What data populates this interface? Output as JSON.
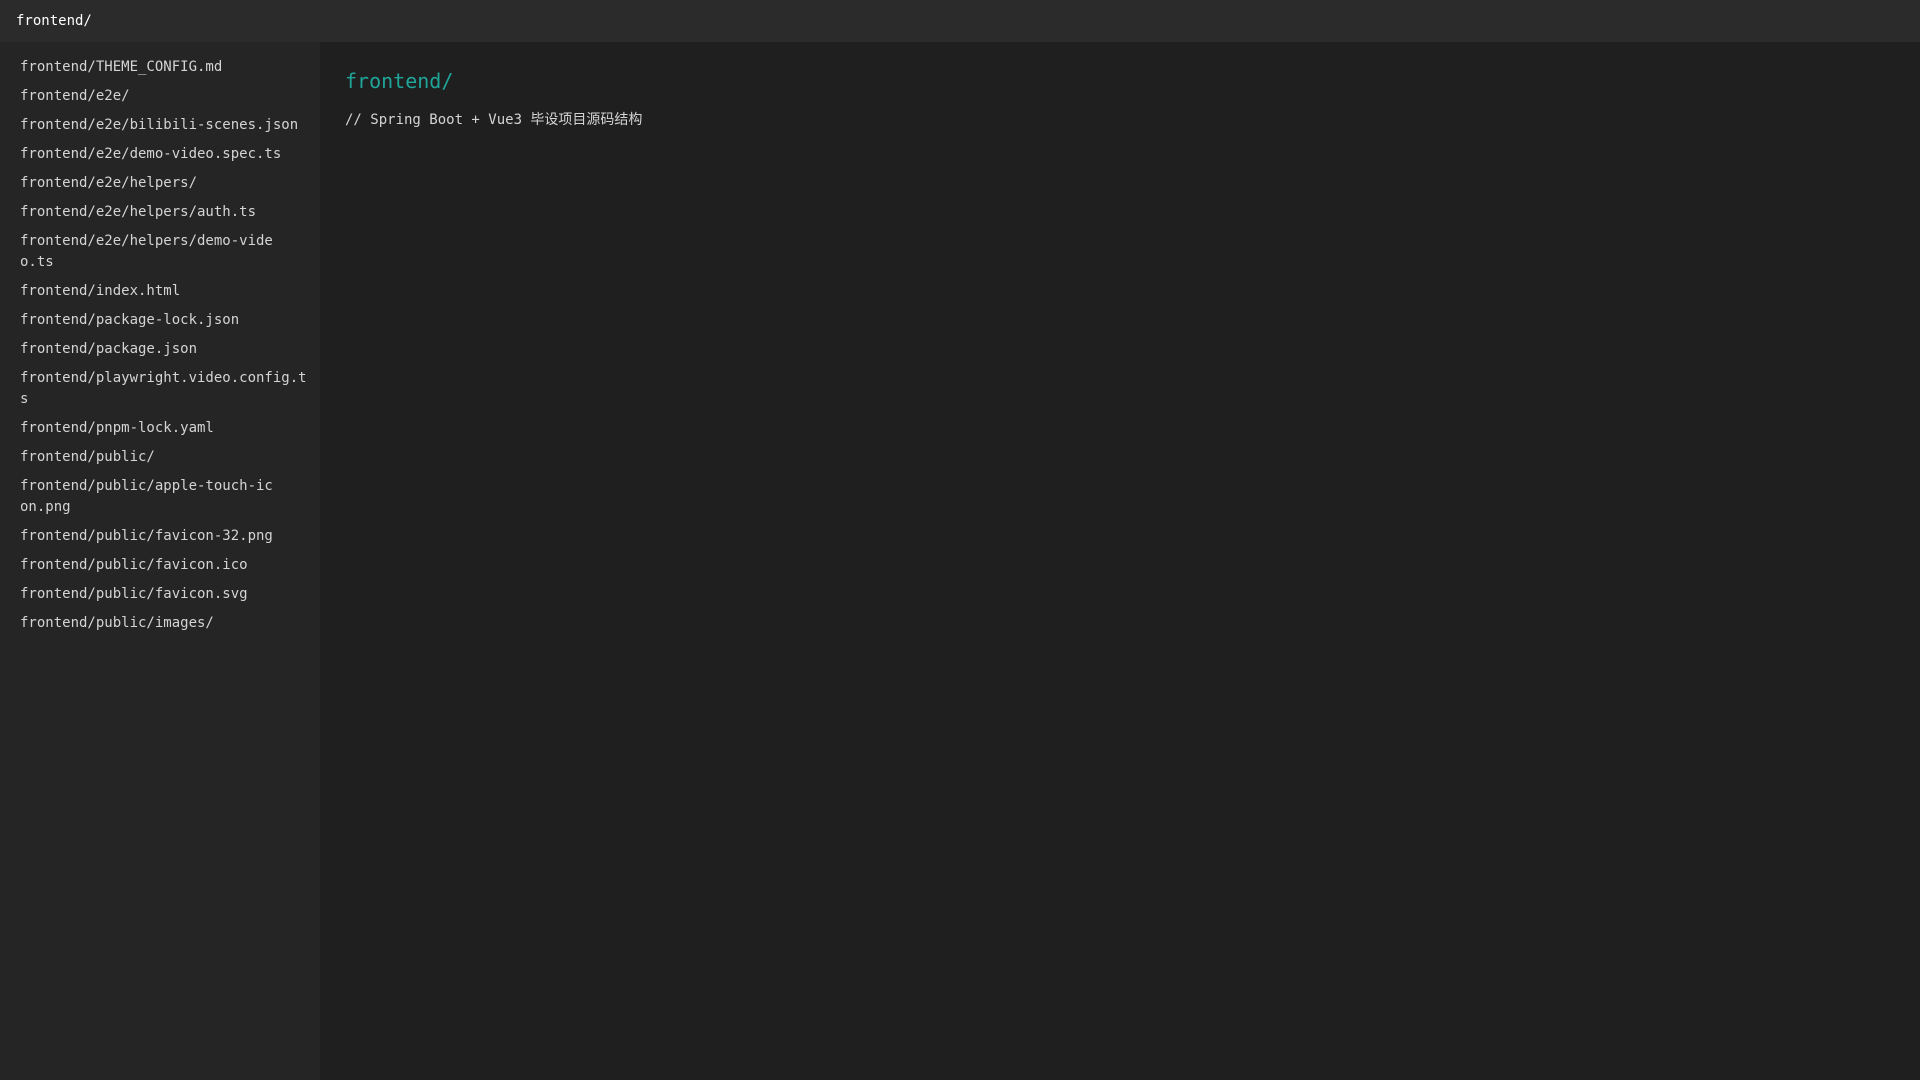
{
  "window": {
    "title": "frontend/"
  },
  "sidebar": {
    "items": [
      {
        "label": "frontend/THEME_CONFIG.md"
      },
      {
        "label": "frontend/e2e/"
      },
      {
        "label": "frontend/e2e/bilibili-scenes.json"
      },
      {
        "label": "frontend/e2e/demo-video.spec.ts"
      },
      {
        "label": "frontend/e2e/helpers/"
      },
      {
        "label": "frontend/e2e/helpers/auth.ts"
      },
      {
        "label": "frontend/e2e/helpers/demo-video.ts"
      },
      {
        "label": "frontend/index.html"
      },
      {
        "label": "frontend/package-lock.json"
      },
      {
        "label": "frontend/package.json"
      },
      {
        "label": "frontend/playwright.video.config.ts"
      },
      {
        "label": "frontend/pnpm-lock.yaml"
      },
      {
        "label": "frontend/public/"
      },
      {
        "label": "frontend/public/apple-touch-icon.png"
      },
      {
        "label": "frontend/public/favicon-32.png"
      },
      {
        "label": "frontend/public/favicon.ico"
      },
      {
        "label": "frontend/public/favicon.svg"
      },
      {
        "label": "frontend/public/images/"
      }
    ]
  },
  "main": {
    "title": "frontend/",
    "comment": "// Spring Boot + Vue3 毕设项目源码结构"
  },
  "colors": {
    "accent": "#1fa59a",
    "background": "#1f1f1f",
    "sidebar_background": "#252526",
    "titlebar_background": "#2b2b2b"
  }
}
